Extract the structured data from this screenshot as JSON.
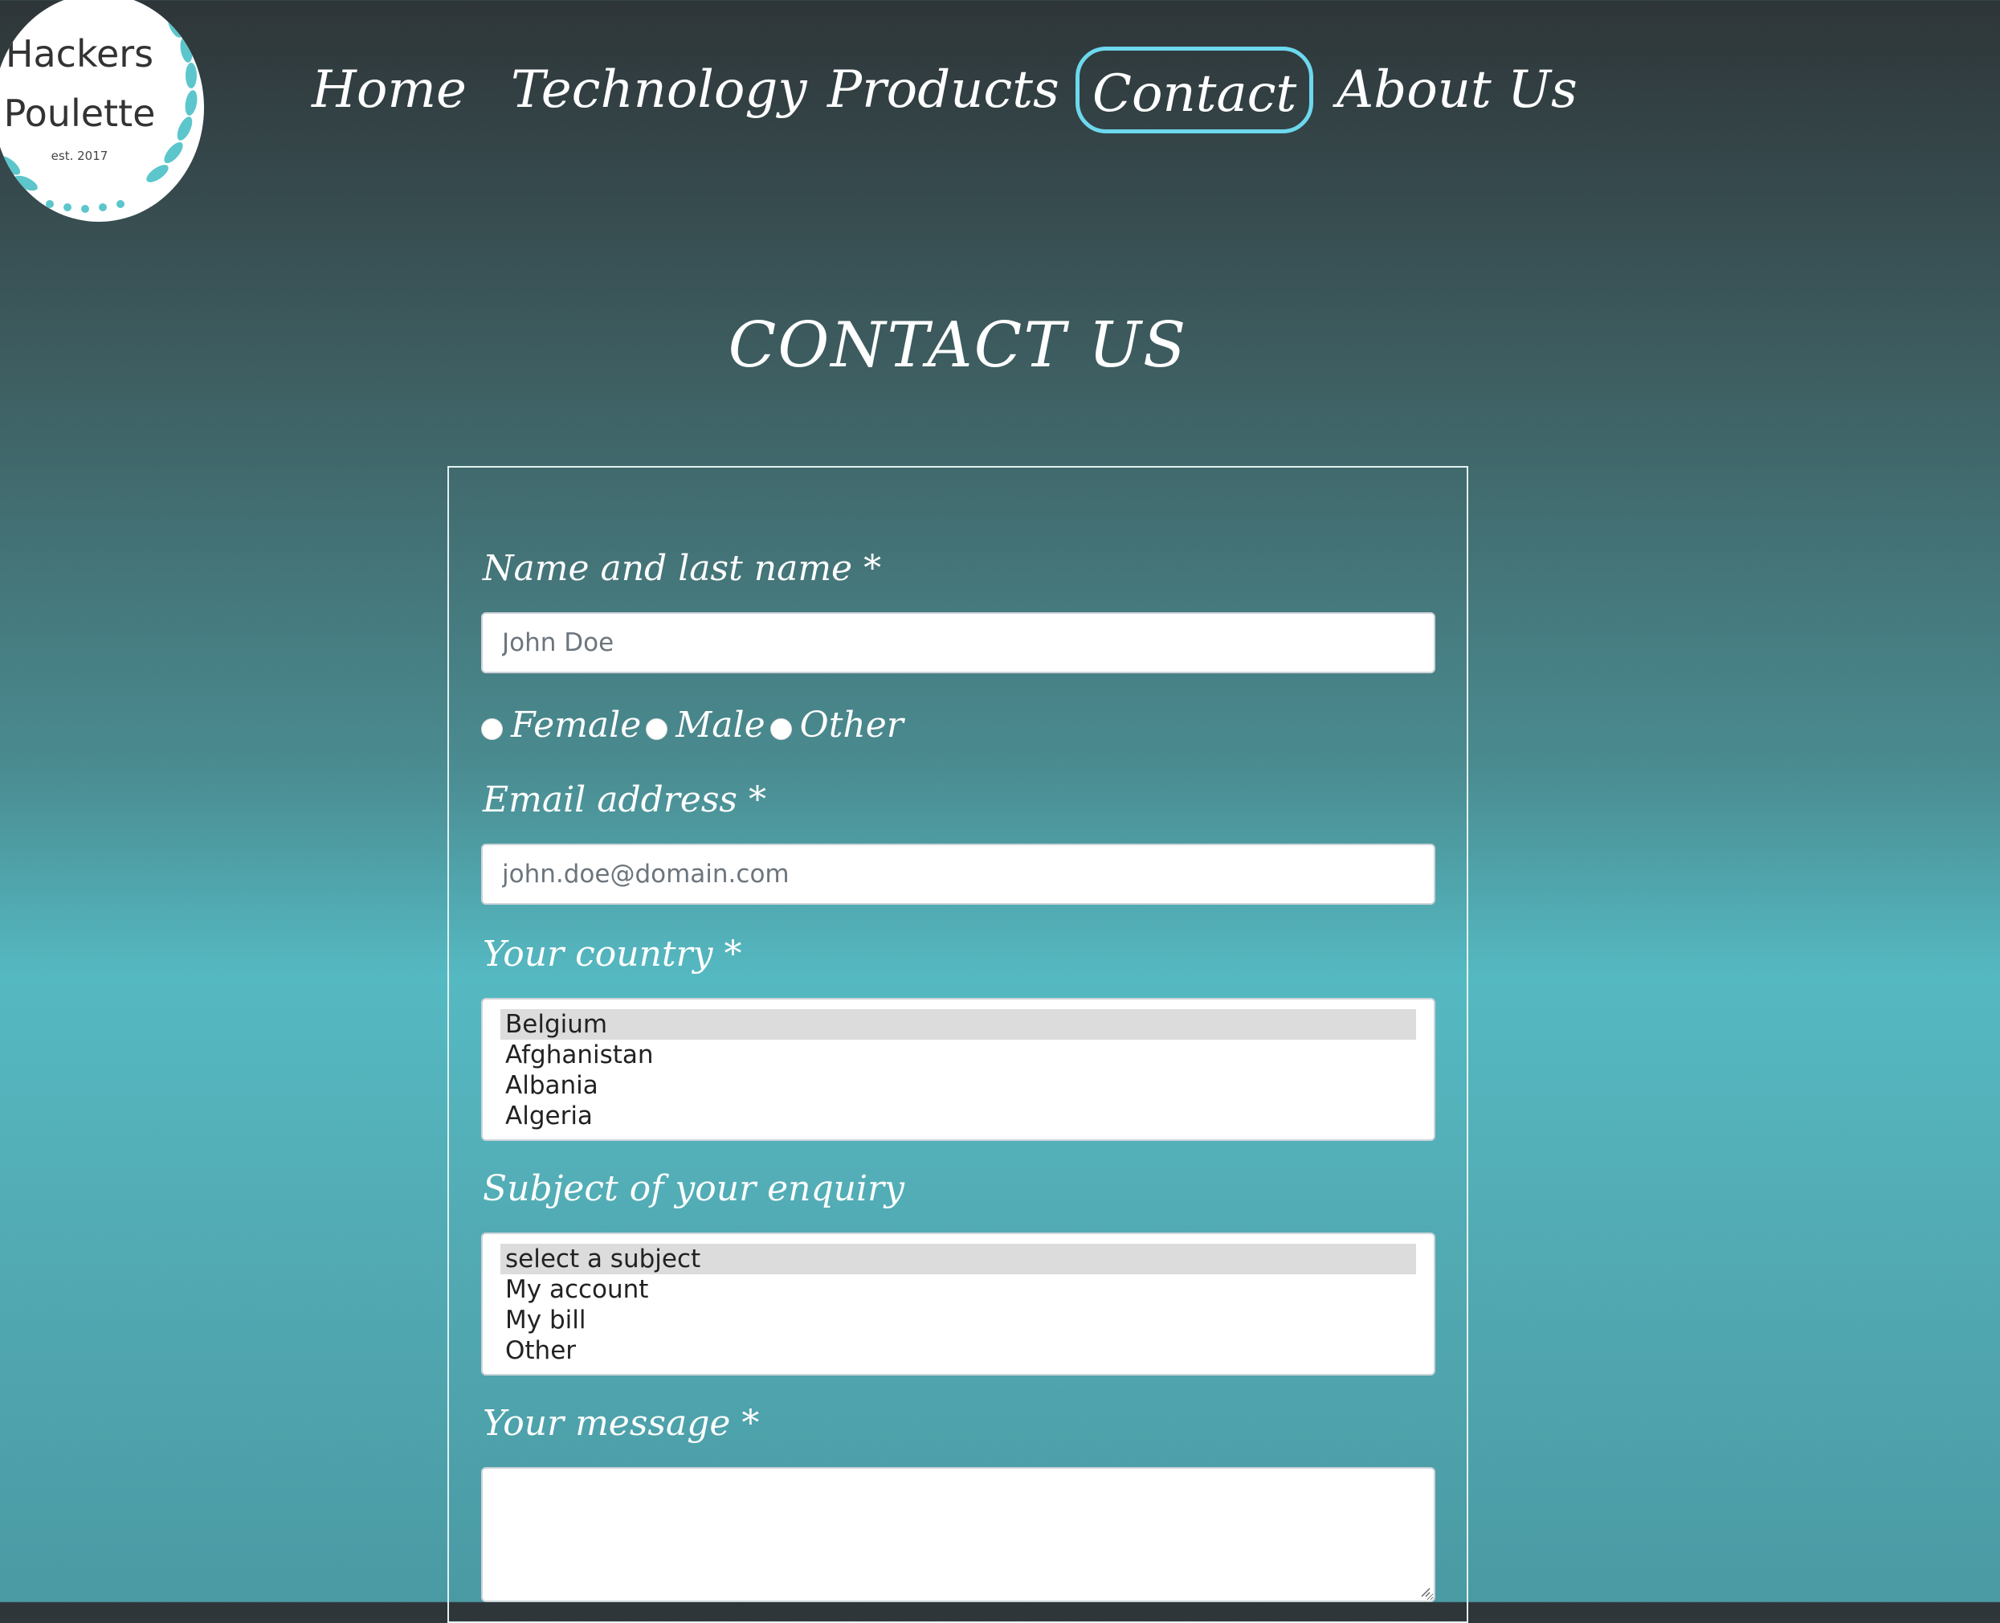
{
  "logo": {
    "line1": "Hackers",
    "line2": "Poulette",
    "est": "est. 2017"
  },
  "nav": {
    "items": [
      {
        "label": "Home"
      },
      {
        "label": "Technology"
      },
      {
        "label": "Products"
      },
      {
        "label": "Contact",
        "active": true
      },
      {
        "label": "About Us"
      }
    ]
  },
  "page": {
    "title": "CONTACT US"
  },
  "form": {
    "name_label": "Name and last name *",
    "name_placeholder": "John Doe",
    "gender_options": [
      "Female",
      "Male",
      "Other"
    ],
    "email_label": "Email address *",
    "email_placeholder": "john.doe@domain.com",
    "country_label": "Your country *",
    "country_options": [
      "Belgium",
      "Afghanistan",
      "Albania",
      "Algeria"
    ],
    "country_selected": "Belgium",
    "subject_label": "Subject of your enquiry",
    "subject_options": [
      "select a subject",
      "My account",
      "My bill",
      "Other"
    ],
    "subject_selected": "select a subject",
    "message_label": "Your message *"
  },
  "colors": {
    "accent": "#6dd8ee",
    "logo_leaf": "#5cc6cc",
    "field_border": "#ced4da"
  }
}
